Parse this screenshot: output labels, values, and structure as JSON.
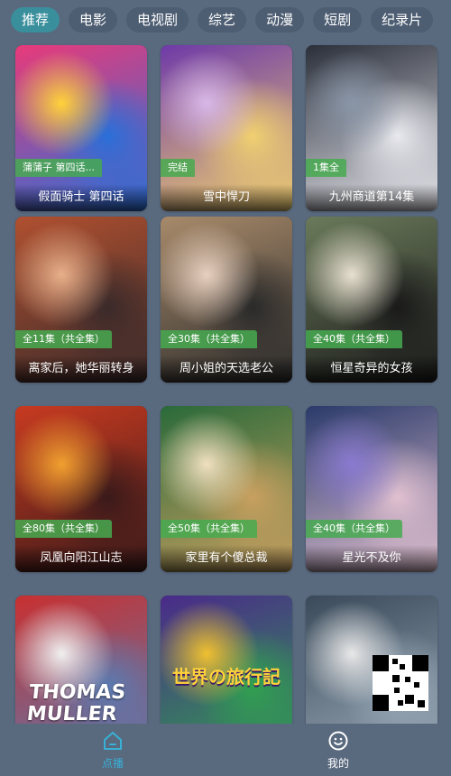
{
  "tabs": [
    {
      "label": "推荐",
      "active": true
    },
    {
      "label": "电影",
      "active": false
    },
    {
      "label": "电视剧",
      "active": false
    },
    {
      "label": "综艺",
      "active": false
    },
    {
      "label": "动漫",
      "active": false
    },
    {
      "label": "短剧",
      "active": false
    },
    {
      "label": "纪录片",
      "active": false
    }
  ],
  "cards": [
    {
      "badge": "蒲蒲子 第四话...",
      "title": "假面骑士 第四话",
      "row": 0,
      "col": 0,
      "colors": [
        "#e83a7a",
        "#ffd23a",
        "#2a6fd8"
      ]
    },
    {
      "badge": "完结",
      "title": "雪中悍刀",
      "row": 0,
      "col": 1,
      "colors": [
        "#6e3aa8",
        "#d8b8e8",
        "#f0d070"
      ]
    },
    {
      "badge": "1集全",
      "title": "九州商道第14集",
      "row": 0,
      "col": 2,
      "colors": [
        "#2a2f3a",
        "#8a96a8",
        "#e8e8ee"
      ]
    },
    {
      "badge": "全11集（共全集）",
      "title": "离家后，她华丽转身",
      "row": 1,
      "col": 0,
      "colors": [
        "#b05030",
        "#e8b08a",
        "#3a2a2a"
      ]
    },
    {
      "badge": "全30集（共全集）",
      "title": "周小姐的天选老公",
      "row": 1,
      "col": 1,
      "colors": [
        "#a88a6a",
        "#e8d0c0",
        "#2a2a2a"
      ]
    },
    {
      "badge": "全40集（共全集）",
      "title": "恒星奇异的女孩",
      "row": 1,
      "col": 2,
      "colors": [
        "#6a7a5a",
        "#e8e0d0",
        "#1a1a1a"
      ]
    },
    {
      "badge": "全80集（共全集）",
      "title": "凤凰向阳江山志",
      "row": 2,
      "col": 0,
      "colors": [
        "#c83a20",
        "#f0a030",
        "#3a1a1a"
      ]
    },
    {
      "badge": "全50集（共全集）",
      "title": "家里有个傻总裁",
      "row": 2,
      "col": 1,
      "colors": [
        "#2a6a3a",
        "#f0e0c0",
        "#c8a060"
      ]
    },
    {
      "badge": "全40集（共全集）",
      "title": "星光不及你",
      "row": 2,
      "col": 2,
      "colors": [
        "#2a3a6a",
        "#8a7ad0",
        "#e0c0d0"
      ]
    },
    {
      "badge": "",
      "title": "",
      "row": 3,
      "col": 0,
      "colors": [
        "#c83030",
        "#f0f0f0",
        "#5a7ab0"
      ]
    },
    {
      "badge": "",
      "title": "",
      "row": 3,
      "col": 1,
      "colors": [
        "#4a2a8a",
        "#f0c030",
        "#30a050"
      ]
    },
    {
      "badge": "",
      "title": "",
      "row": 3,
      "col": 2,
      "colors": [
        "#3a4a5a",
        "#e8e8e8",
        "#9aaab8"
      ]
    }
  ],
  "posterTexts": {
    "card9": "THOMAS\nMULLER",
    "card10": "世界の旅行記"
  },
  "nav": [
    {
      "label": "点播",
      "icon": "home-icon",
      "active": true
    },
    {
      "label": "我的",
      "icon": "smile-icon",
      "active": false
    }
  ]
}
